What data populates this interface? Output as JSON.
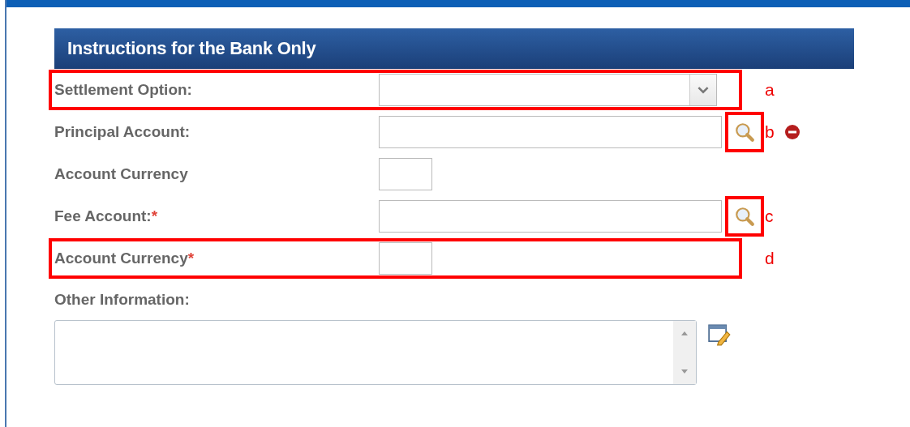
{
  "section": {
    "title": "Instructions for the Bank Only"
  },
  "fields": [
    {
      "kind": "select",
      "label": "Settlement Option:",
      "callout": "a",
      "row_framed": true,
      "error": false
    },
    {
      "kind": "lookup",
      "label": "Principal Account:",
      "callout": "b",
      "row_framed": false,
      "button_framed": true,
      "error": true
    },
    {
      "kind": "short",
      "label": "Account Currency",
      "row_framed": false,
      "error": false
    },
    {
      "kind": "lookup",
      "label": "Fee Account:",
      "required_mark": "*",
      "callout": "c",
      "row_framed": false,
      "button_framed": true,
      "error": false
    },
    {
      "kind": "short",
      "label": "Account Currency",
      "required_mark": "*",
      "callout": "d",
      "row_framed": true,
      "error": false
    },
    {
      "kind": "textarea",
      "label": "Other Information:"
    }
  ]
}
